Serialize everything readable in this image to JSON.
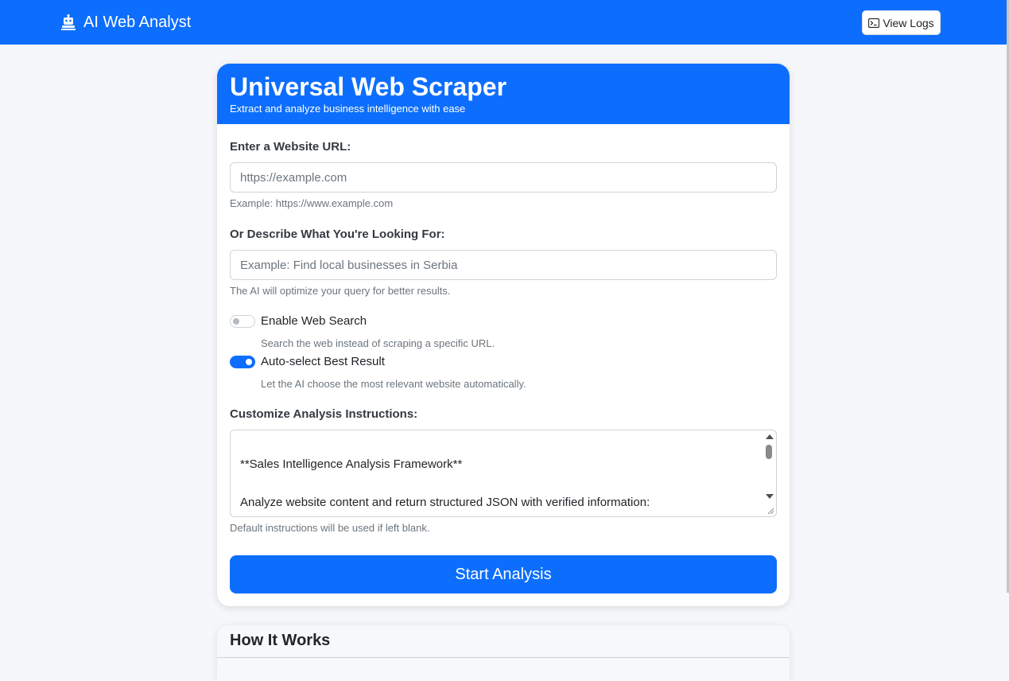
{
  "navbar": {
    "brand": "AI Web Analyst",
    "brand_icon": "robot-icon",
    "view_logs_label": "View Logs",
    "view_logs_icon": "terminal-icon"
  },
  "colors": {
    "primary": "#0d6efd",
    "background": "#f5f7fa"
  },
  "form": {
    "title": "Universal Web Scraper",
    "subtitle": "Extract and analyze business intelligence with ease",
    "url": {
      "label": "Enter a Website URL:",
      "placeholder": "https://example.com",
      "value": "",
      "help": "Example: https://www.example.com"
    },
    "query": {
      "label": "Or Describe What You're Looking For:",
      "placeholder": "Example: Find local businesses in Serbia",
      "value": "",
      "help": "The AI will optimize your query for better results."
    },
    "web_search": {
      "label": "Enable Web Search",
      "help": "Search the web instead of scraping a specific URL.",
      "enabled": false
    },
    "auto_select": {
      "label": "Auto-select Best Result",
      "help": "Let the AI choose the most relevant website automatically.",
      "enabled": true
    },
    "instructions": {
      "label": "Customize Analysis Instructions:",
      "lines": [
        "**Sales Intelligence Analysis Framework**",
        "Analyze website content and return structured JSON with verified information:"
      ],
      "help": "Default instructions will be used if left blank."
    },
    "start_label": "Start Analysis"
  },
  "how_it_works": {
    "title": "How It Works"
  }
}
